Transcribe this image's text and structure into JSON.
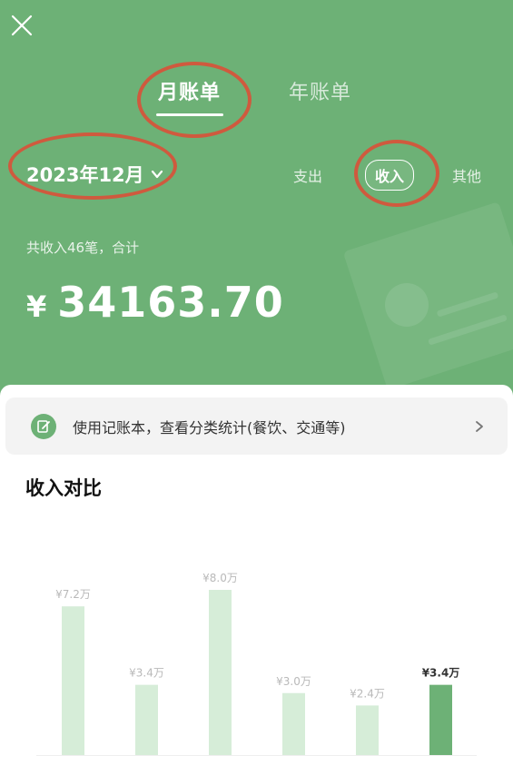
{
  "header": {
    "tabs": [
      {
        "label": "月账单",
        "active": true
      },
      {
        "label": "年账单",
        "active": false
      }
    ],
    "month": "2023年12月",
    "filters": [
      {
        "label": "支出",
        "active": false
      },
      {
        "label": "收入",
        "active": true
      },
      {
        "label": "其他",
        "active": false
      }
    ],
    "summary": "共收入46笔，合计",
    "currency": "¥",
    "total": "34163.70"
  },
  "banner": {
    "text": "使用记账本，查看分类统计(餐饮、交通等)",
    "icon": "edit-note-icon"
  },
  "section_title": "收入对比",
  "colors": {
    "header_bg": "#6db176",
    "bar_light": "#d6edd8",
    "bar_highlight": "#6db176",
    "annotation": "#cf5a3e"
  },
  "chart_data": {
    "type": "bar",
    "categories": [
      "",
      "",
      "",
      "",
      "",
      ""
    ],
    "values": [
      7.2,
      3.4,
      8.0,
      3.0,
      2.4,
      3.4
    ],
    "labels": [
      "¥7.2万",
      "¥3.4万",
      "¥8.0万",
      "¥3.0万",
      "¥2.4万",
      "¥3.4万"
    ],
    "highlight_index": 5,
    "ylim": [
      0,
      8.0
    ]
  }
}
